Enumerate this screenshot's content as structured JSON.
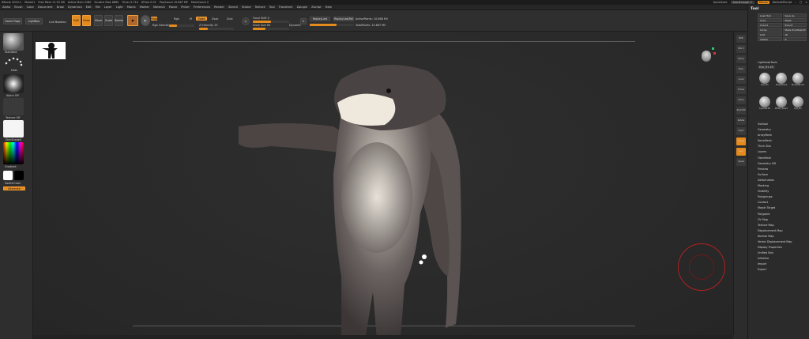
{
  "titlebar": {
    "app": "ZBrush 2023.1",
    "file": "Mulai21",
    "free_mem": "Free Mem 11.53 GB",
    "active_mem": "Active Mem 2280",
    "scratch": "Scratch Disk 6660",
    "timer": "Timer 0.714",
    "atime": "ATime 0.01",
    "polycount": "PolyCount 10.667 MP",
    "meshcount": "MeshCount 2",
    "quicksave": "QuickSave",
    "see_through": "See-through 0",
    "menus": "Menus",
    "script": "DefaultZScript"
  },
  "menubar": [
    "Alpha",
    "Brush",
    "Color",
    "Document",
    "Draw",
    "Dynamics",
    "Edit",
    "File",
    "Layer",
    "Light",
    "Macro",
    "Marker",
    "Material",
    "Movie",
    "Picker",
    "Preferences",
    "Render",
    "Stencil",
    "Stroke",
    "Texture",
    "Tool",
    "Transform",
    "Zplugin",
    "Zscript",
    "Help"
  ],
  "topshelf": {
    "home_page": "Home Page",
    "lightbox": "LightBox",
    "live_boolean": "Live Boolean",
    "edit": "Edit",
    "draw": "Draw",
    "move": "Move",
    "scale": "Scale",
    "rotate": "Rotate",
    "mrgb": "Mrgb",
    "rgb": "Rgb",
    "m": "M",
    "zadd": "Zadd",
    "zsub": "Zsub",
    "zcut": "Zcut",
    "rgb_intensity": "Rgb Intensity",
    "z_intensity": "Z Intensity 25",
    "focal_shift": "Focal Shift 0",
    "draw_size": "Draw Size 64",
    "dynamic": "Dynamic",
    "replay_last": "ReplayLast",
    "replay_last_rel": "ReplayLastRel",
    "active_points": "ActivePoints: 10.668 Mil",
    "total_points": "TotalPoints: 10.667 Mil",
    "rgb_intensity_level": 0.3,
    "z_intensity_level": 0.25,
    "focal_level": 0.5,
    "draw_size_level": 0.35
  },
  "leftshelf": {
    "brush": "Standard",
    "stroke": "Dots",
    "alpha": "Alpha Off",
    "texture": "Texture Off",
    "material": "SkinShade4",
    "gradient": "Gradient",
    "switch_color": "SwitchColor",
    "alternate": "Alternate"
  },
  "rightshelf": [
    "BPR",
    "SPix 3",
    "Persp",
    "Floor",
    "Local",
    "Frame",
    "Move",
    "Zoom3D",
    "Rotate",
    "PolyF",
    "Transp",
    "Solo",
    "Xpose"
  ],
  "tray": {
    "title": "Tool",
    "buttons": [
      "Load Tool",
      "Save As",
      "Copy",
      "Paste",
      "Import",
      "Export",
      "Clone",
      "Make PolyMesh3D",
      "GoZ",
      "All",
      "Visible",
      "R"
    ],
    "lightbox_tools": "Lightbox▸Tools",
    "current_tool": "Eye_R1  49",
    "thumbs": [
      "Eye_R1",
      "PolySphere",
      "SimpleBrush",
      "Cylinder3D",
      "PM3D_Shark",
      "Eye_R1"
    ],
    "sections": [
      "Subtool",
      "Geometry",
      "ArrayMesh",
      "NanoMesh",
      "Thick Skin",
      "Layers",
      "FiberMesh",
      "Geometry HD",
      "Preview",
      "Surface",
      "Deformation",
      "Masking",
      "Visibility",
      "Polygroups",
      "Contact",
      "Morph Target",
      "Polypaint",
      "UV Map",
      "Texture Map",
      "Displacement Map",
      "Normal Map",
      "Vector Displacement Map",
      "Display Properties",
      "Unified Skin",
      "Initialize",
      "Import",
      "Export"
    ]
  },
  "colors": {
    "accent": "#e58a1d",
    "main_color": "#ffffff",
    "secondary_color": "#000000"
  }
}
